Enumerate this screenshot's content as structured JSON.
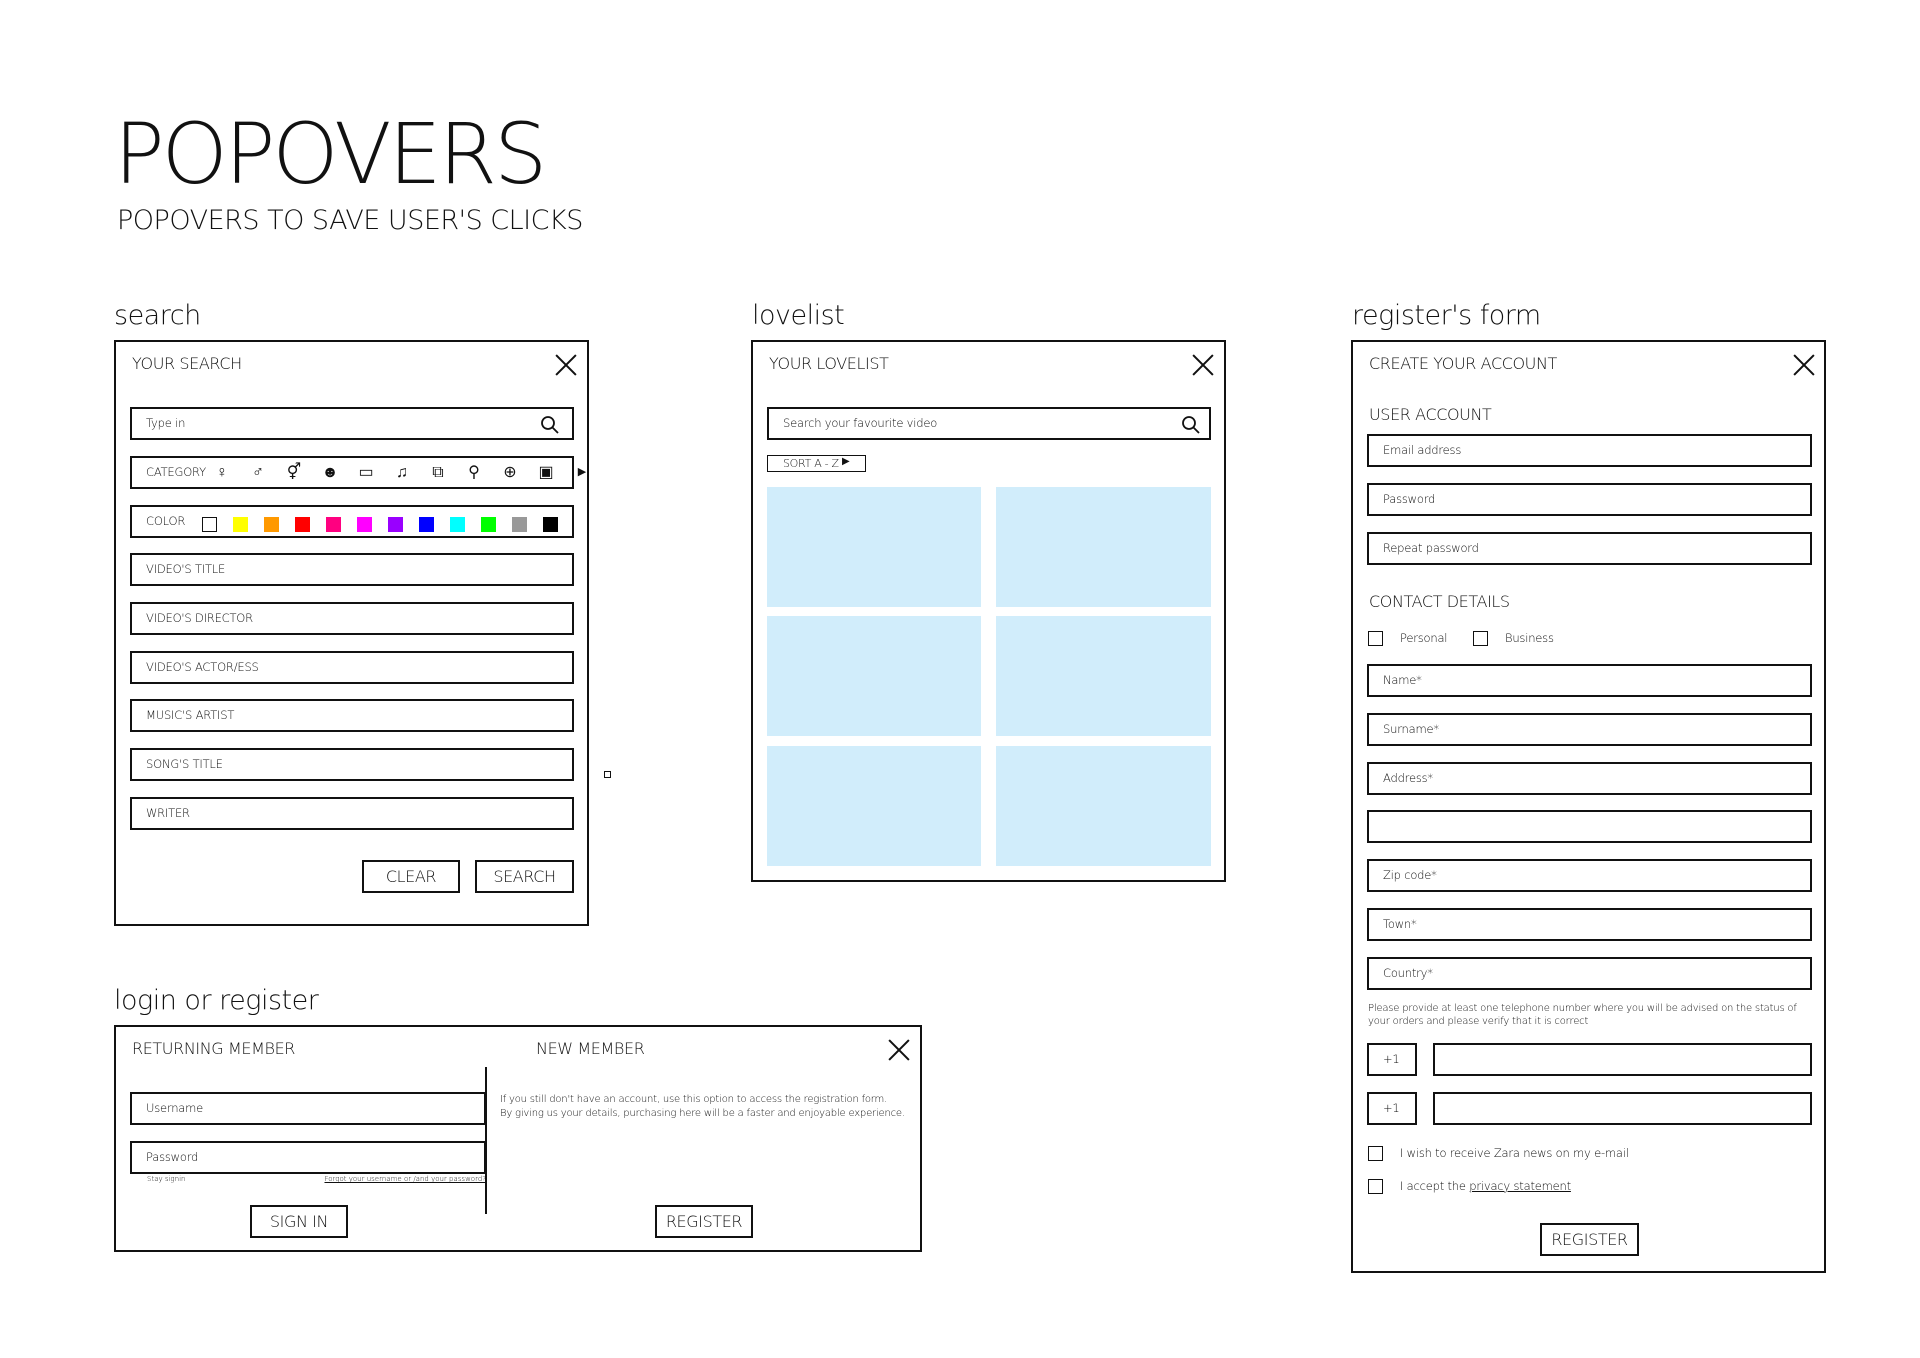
{
  "page": {
    "title": "POPOVERS",
    "subtitle": "POPOVERS TO SAVE USER'S CLICKS"
  },
  "search": {
    "section_title": "search",
    "header": "YOUR SEARCH",
    "input_placeholder": "Type in",
    "category_label": "CATEGORY",
    "category_icons": [
      "female-icon",
      "male-icon",
      "transgender-icon",
      "kids-icon",
      "video-icon",
      "music-icon",
      "book-icon",
      "microphone-icon",
      "gamepad-icon",
      "chip-icon"
    ],
    "color_label": "COLOR",
    "colors": [
      "#ffffff",
      "#ffff00",
      "#ff9900",
      "#ff0000",
      "#ff0080",
      "#ff00ff",
      "#9900ff",
      "#0000ff",
      "#00ffff",
      "#00ff00",
      "#999999",
      "#000000"
    ],
    "fields": [
      "VIDEO'S TITLE",
      "VIDEO'S DIRECTOR",
      "VIDEO'S ACTOR/ESS",
      "MUSIC'S ARTIST",
      "SONG'S TITLE",
      "WRITER"
    ],
    "clear_label": "CLEAR",
    "search_label": "SEARCH"
  },
  "lovelist": {
    "section_title": "lovelist",
    "header": "YOUR LOVELIST",
    "input_placeholder": "Search your favourite video",
    "sort_label": "SORT A - Z"
  },
  "login": {
    "section_title": "login or register",
    "returning_header": "RETURNING MEMBER",
    "username_placeholder": "Username",
    "password_placeholder": "Password",
    "stay_signin": "Stay signin",
    "forgot_link": "Forgot your username or /and your password?",
    "signin_label": "SIGN IN",
    "new_header": "NEW MEMBER",
    "new_text_1": "If you still don't have an account, use this option to access the registration form.",
    "new_text_2": "By giving us your details, purchasing here will be a faster and enjoyable experience.",
    "register_label": "REGISTER"
  },
  "register": {
    "section_title": "register's form",
    "header": "CREATE YOUR ACCOUNT",
    "user_account": "USER ACCOUNT",
    "email": "Email address",
    "password": "Password",
    "repeat_password": "Repeat password",
    "contact_details": "CONTACT DETAILS",
    "personal": "Personal",
    "business": "Business",
    "name": "Name*",
    "surname": "Surname*",
    "address": "Address*",
    "address2": "",
    "zip": "Zip code*",
    "town": "Town*",
    "country": "Country*",
    "phone_note_1": "Please provide at least one telephone number where you will be advised on the status of",
    "phone_note_2": "your orders and please verify that it is correct",
    "phone_prefix_1": "+1",
    "phone_prefix_2": "+1",
    "news_checkbox": "I wish to receive Zara news on my e-mail",
    "accept_prefix": "I accept the",
    "privacy_link": "privacy statement",
    "register_label": "REGISTER"
  }
}
